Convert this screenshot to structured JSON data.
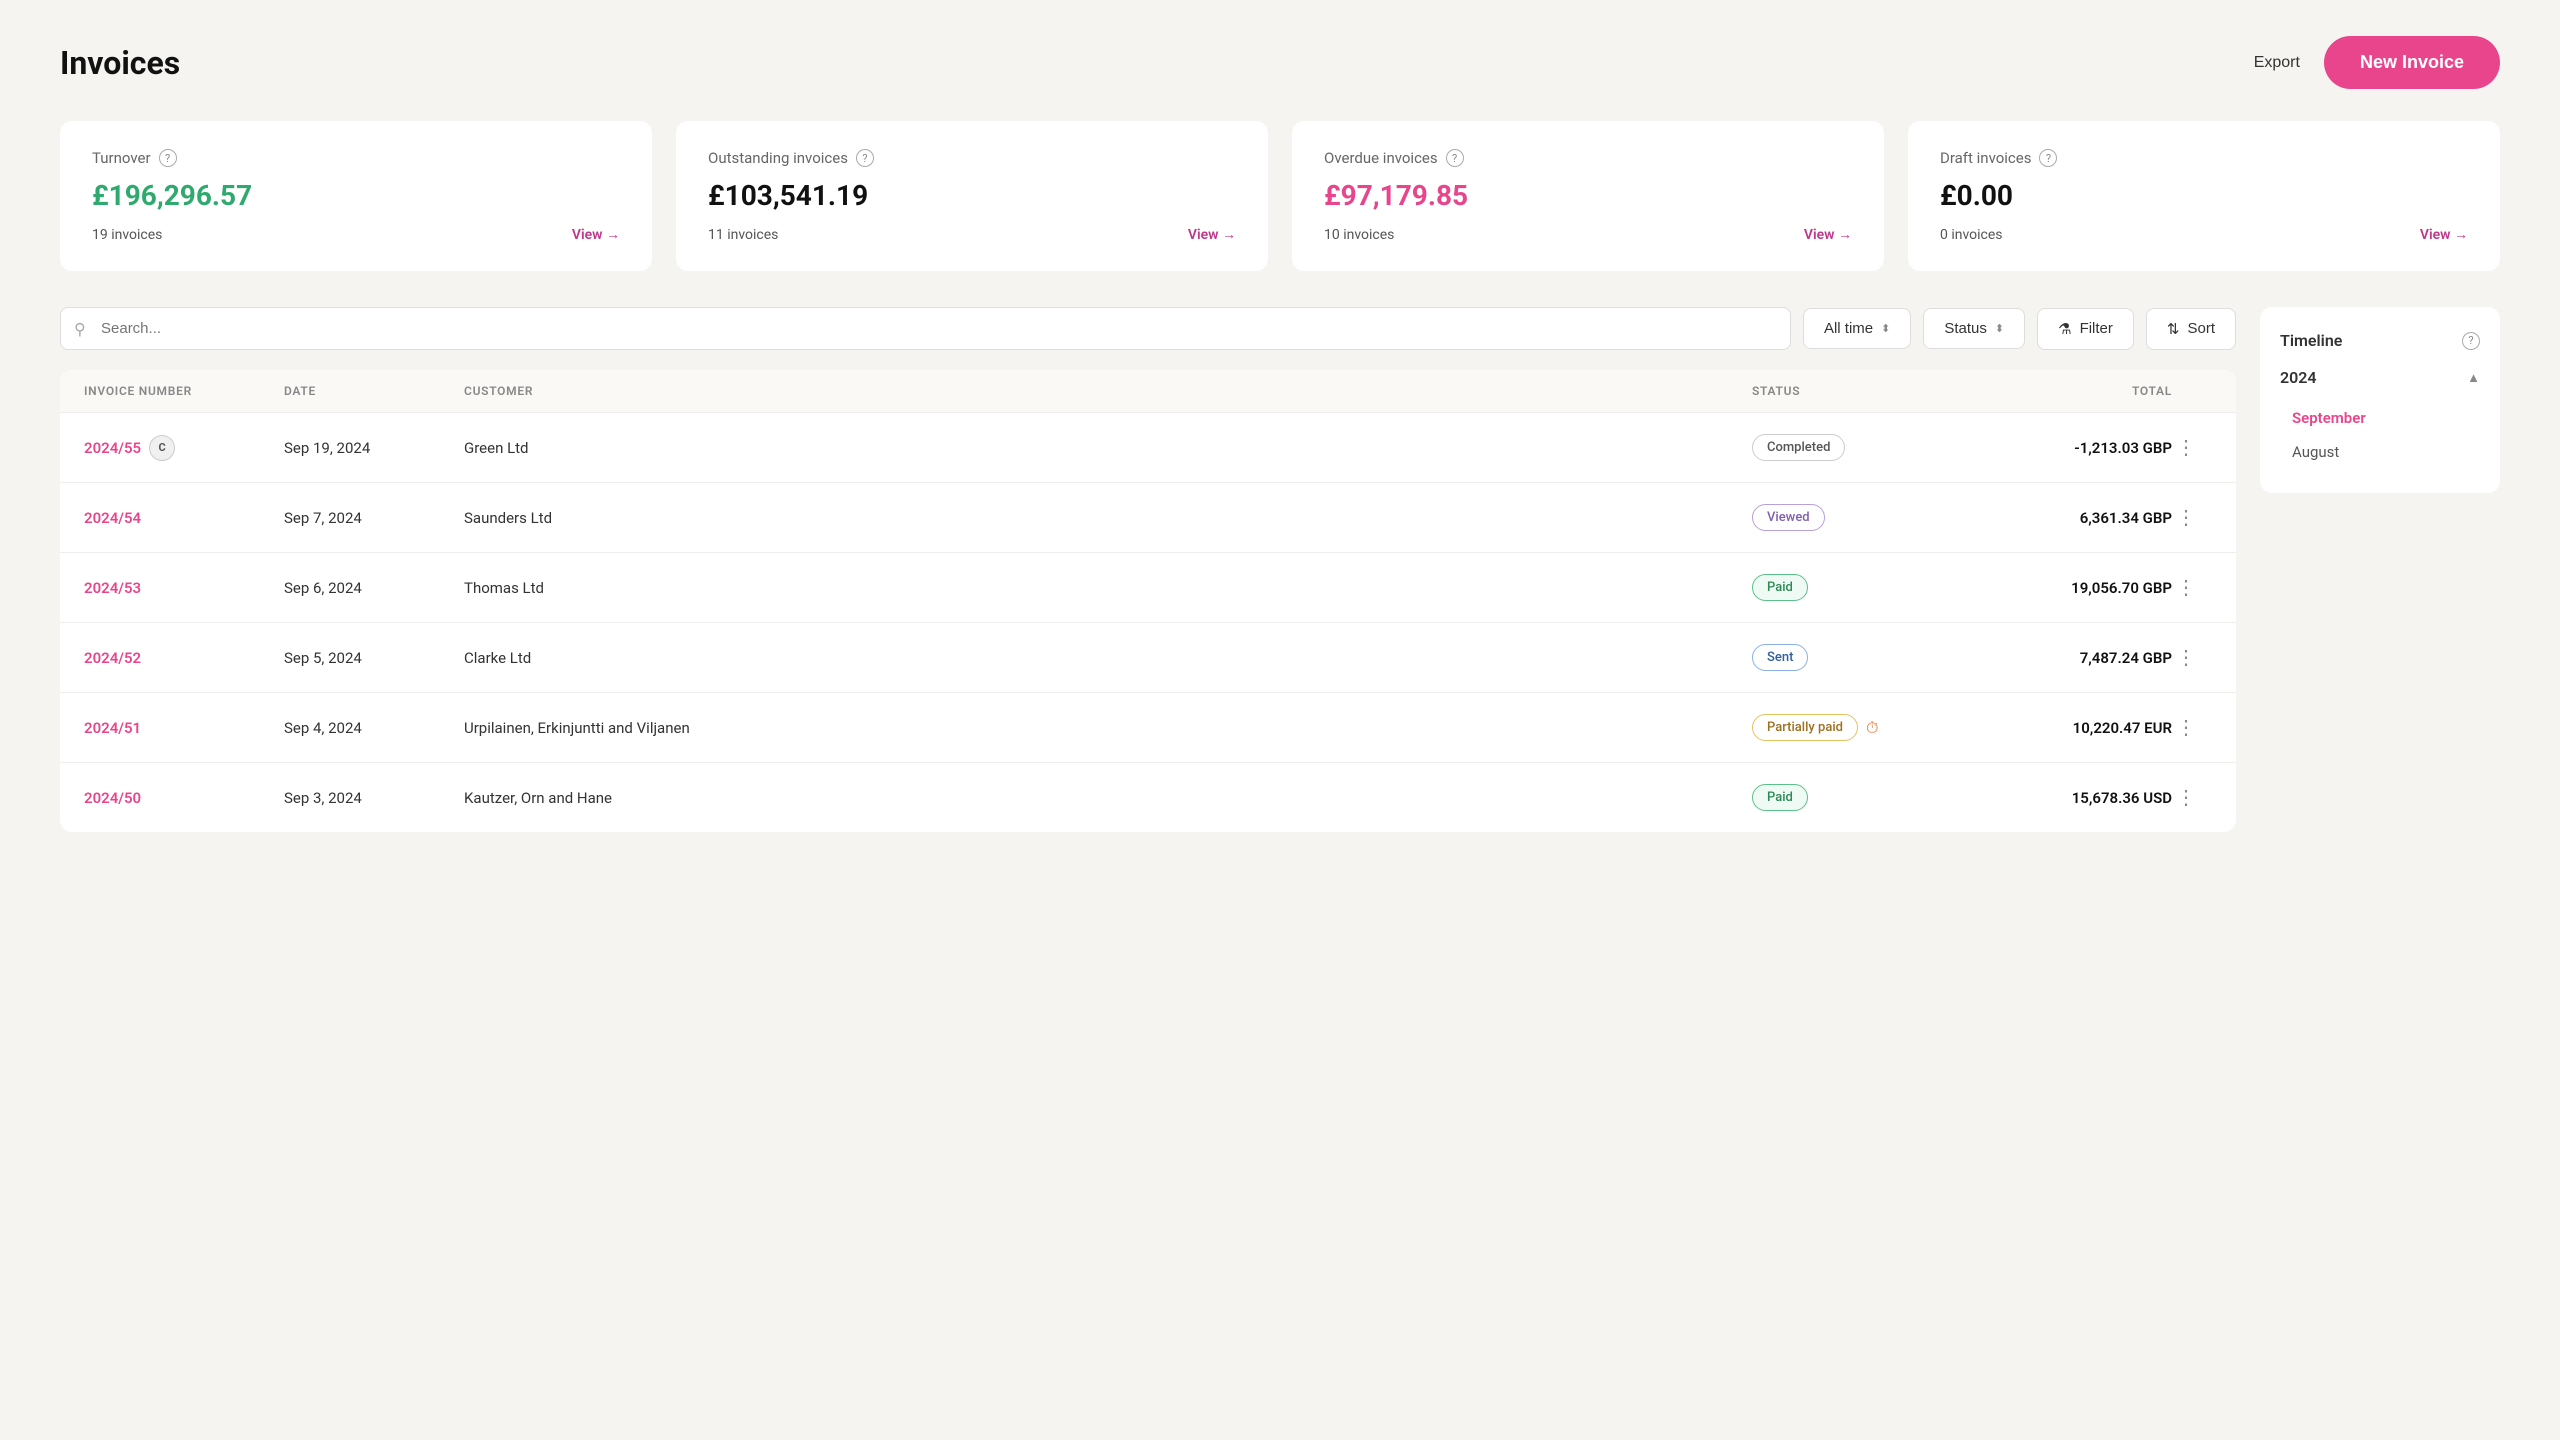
{
  "header": {
    "title": "Invoices",
    "export_label": "Export",
    "new_invoice_label": "New Invoice"
  },
  "cards": [
    {
      "id": "turnover",
      "label": "Turnover",
      "amount": "£196,296.57",
      "amount_color": "green",
      "count": "19 invoices",
      "view_label": "View →"
    },
    {
      "id": "outstanding",
      "label": "Outstanding invoices",
      "amount": "£103,541.19",
      "amount_color": "black",
      "count": "11 invoices",
      "view_label": "View →"
    },
    {
      "id": "overdue",
      "label": "Overdue invoices",
      "amount": "£97,179.85",
      "amount_color": "red",
      "count": "10 invoices",
      "view_label": "View →"
    },
    {
      "id": "draft",
      "label": "Draft invoices",
      "amount": "£0.00",
      "amount_color": "black",
      "count": "0 invoices",
      "view_label": "View →"
    }
  ],
  "toolbar": {
    "search_placeholder": "Search...",
    "time_filter": "All time",
    "status_filter": "Status",
    "filter_label": "Filter",
    "sort_label": "Sort"
  },
  "table": {
    "headers": [
      "INVOICE NUMBER",
      "DATE",
      "CUSTOMER",
      "STATUS",
      "TOTAL"
    ],
    "rows": [
      {
        "number": "2024/55",
        "has_avatar": true,
        "avatar_letter": "C",
        "date": "Sep 19, 2024",
        "customer": "Green Ltd",
        "status": "Completed",
        "status_class": "completed",
        "total": "-1,213.03 GBP",
        "has_clock": false
      },
      {
        "number": "2024/54",
        "has_avatar": false,
        "avatar_letter": "",
        "date": "Sep 7, 2024",
        "customer": "Saunders Ltd",
        "status": "Viewed",
        "status_class": "viewed",
        "total": "6,361.34 GBP",
        "has_clock": false
      },
      {
        "number": "2024/53",
        "has_avatar": false,
        "avatar_letter": "",
        "date": "Sep 6, 2024",
        "customer": "Thomas Ltd",
        "status": "Paid",
        "status_class": "paid",
        "total": "19,056.70 GBP",
        "has_clock": false
      },
      {
        "number": "2024/52",
        "has_avatar": false,
        "avatar_letter": "",
        "date": "Sep 5, 2024",
        "customer": "Clarke Ltd",
        "status": "Sent",
        "status_class": "sent",
        "total": "7,487.24 GBP",
        "has_clock": false
      },
      {
        "number": "2024/51",
        "has_avatar": false,
        "avatar_letter": "",
        "date": "Sep 4, 2024",
        "customer": "Urpilainen, Erkinjuntti and Viljanen",
        "status": "Partially paid",
        "status_class": "partially-paid",
        "total": "10,220.47 EUR",
        "has_clock": true
      },
      {
        "number": "2024/50",
        "has_avatar": false,
        "avatar_letter": "",
        "date": "Sep 3, 2024",
        "customer": "Kautzer, Orn and Hane",
        "status": "Paid",
        "status_class": "paid",
        "total": "15,678.36 USD",
        "has_clock": false
      }
    ]
  },
  "timeline": {
    "title": "Timeline",
    "year": "2024",
    "months": [
      {
        "label": "September",
        "active": true
      },
      {
        "label": "August",
        "active": false
      }
    ]
  }
}
